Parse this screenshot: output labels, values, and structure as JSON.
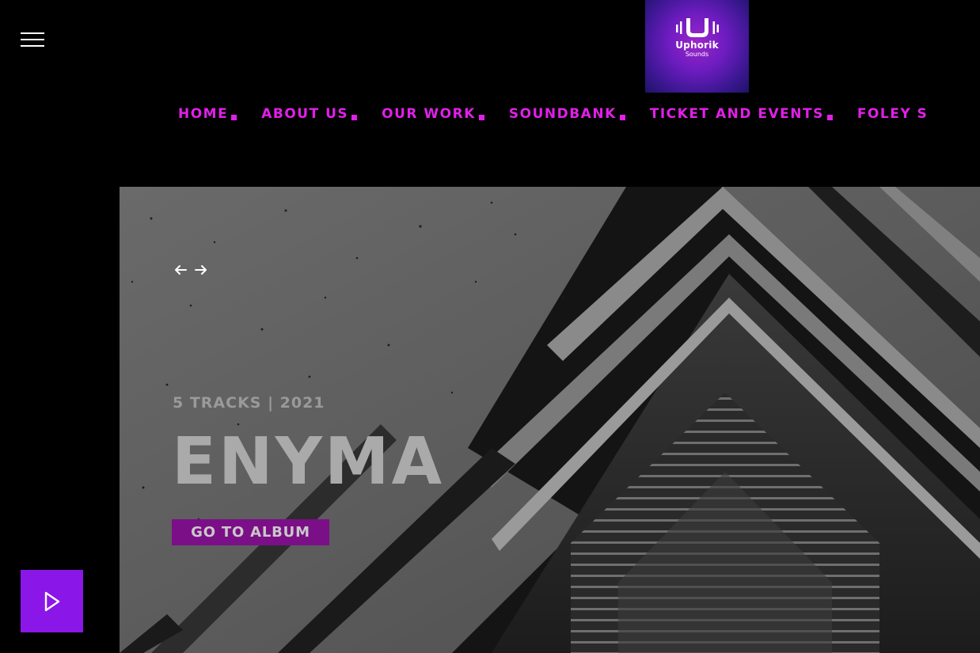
{
  "header": {
    "menu_icon": "hamburger-menu-icon",
    "logo": {
      "name": "Uphorik",
      "sub": "Sounds",
      "icon": "soundwave-u-logo",
      "colors": [
        "#9b26c9",
        "#3a1790"
      ]
    }
  },
  "nav": {
    "accent": "#e21fe9",
    "items": [
      {
        "label": "HOME"
      },
      {
        "label": "ABOUT US"
      },
      {
        "label": "OUR WORK"
      },
      {
        "label": "SOUNDBANK"
      },
      {
        "label": "TICKET AND EVENTS"
      },
      {
        "label": "FOLEY S"
      }
    ]
  },
  "hero": {
    "prev_icon": "arrow-left-icon",
    "next_icon": "arrow-right-icon",
    "tracks_info": "5 TRACKS | 2021",
    "title": "ENYMA",
    "button_label": "GO TO ALBUM",
    "button_color": "#7b0f87"
  },
  "player": {
    "icon": "play-icon",
    "color": "#8a17e8"
  }
}
